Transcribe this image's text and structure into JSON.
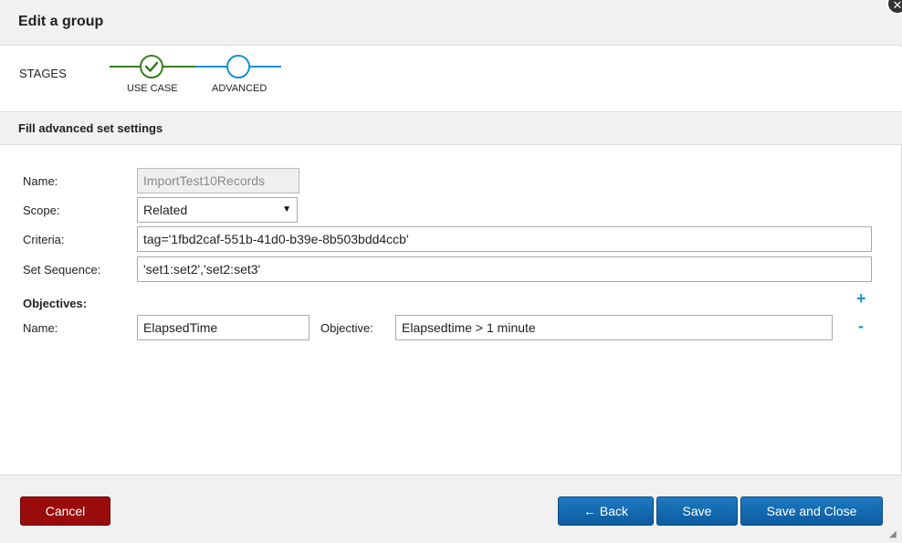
{
  "dialog": {
    "title": "Edit a group",
    "close_icon": "close-icon"
  },
  "stages": {
    "label": "STAGES",
    "items": [
      {
        "label": "USE CASE",
        "status": "complete",
        "color": "#3a7d1f"
      },
      {
        "label": "ADVANCED",
        "status": "current",
        "color": "#1a8fd1"
      }
    ]
  },
  "section": {
    "title": "Fill advanced set settings"
  },
  "form": {
    "name_label": "Name:",
    "name_value": "ImportTest10Records",
    "scope_label": "Scope:",
    "scope_value": "Related",
    "criteria_label": "Criteria:",
    "criteria_value": "tag='1fbd2caf-551b-41d0-b39e-8b503bdd4ccb'",
    "set_sequence_label": "Set Sequence:",
    "set_sequence_value": "'set1:set2','set2:set3'"
  },
  "objectives": {
    "heading": "Objectives:",
    "add_symbol": "+",
    "rows": [
      {
        "name_label": "Name:",
        "name_value": "ElapsedTime",
        "objective_label": "Objective:",
        "objective_value": "Elapsedtime > 1 minute",
        "remove_symbol": "-"
      }
    ]
  },
  "footer": {
    "cancel_label": "Cancel",
    "back_label": "← Back",
    "save_label": "Save",
    "save_close_label": "Save and Close"
  },
  "colors": {
    "cancel": "#9a0b0b",
    "primary": "#1565ad",
    "accent": "#1a8fd1",
    "complete": "#3a7d1f"
  }
}
